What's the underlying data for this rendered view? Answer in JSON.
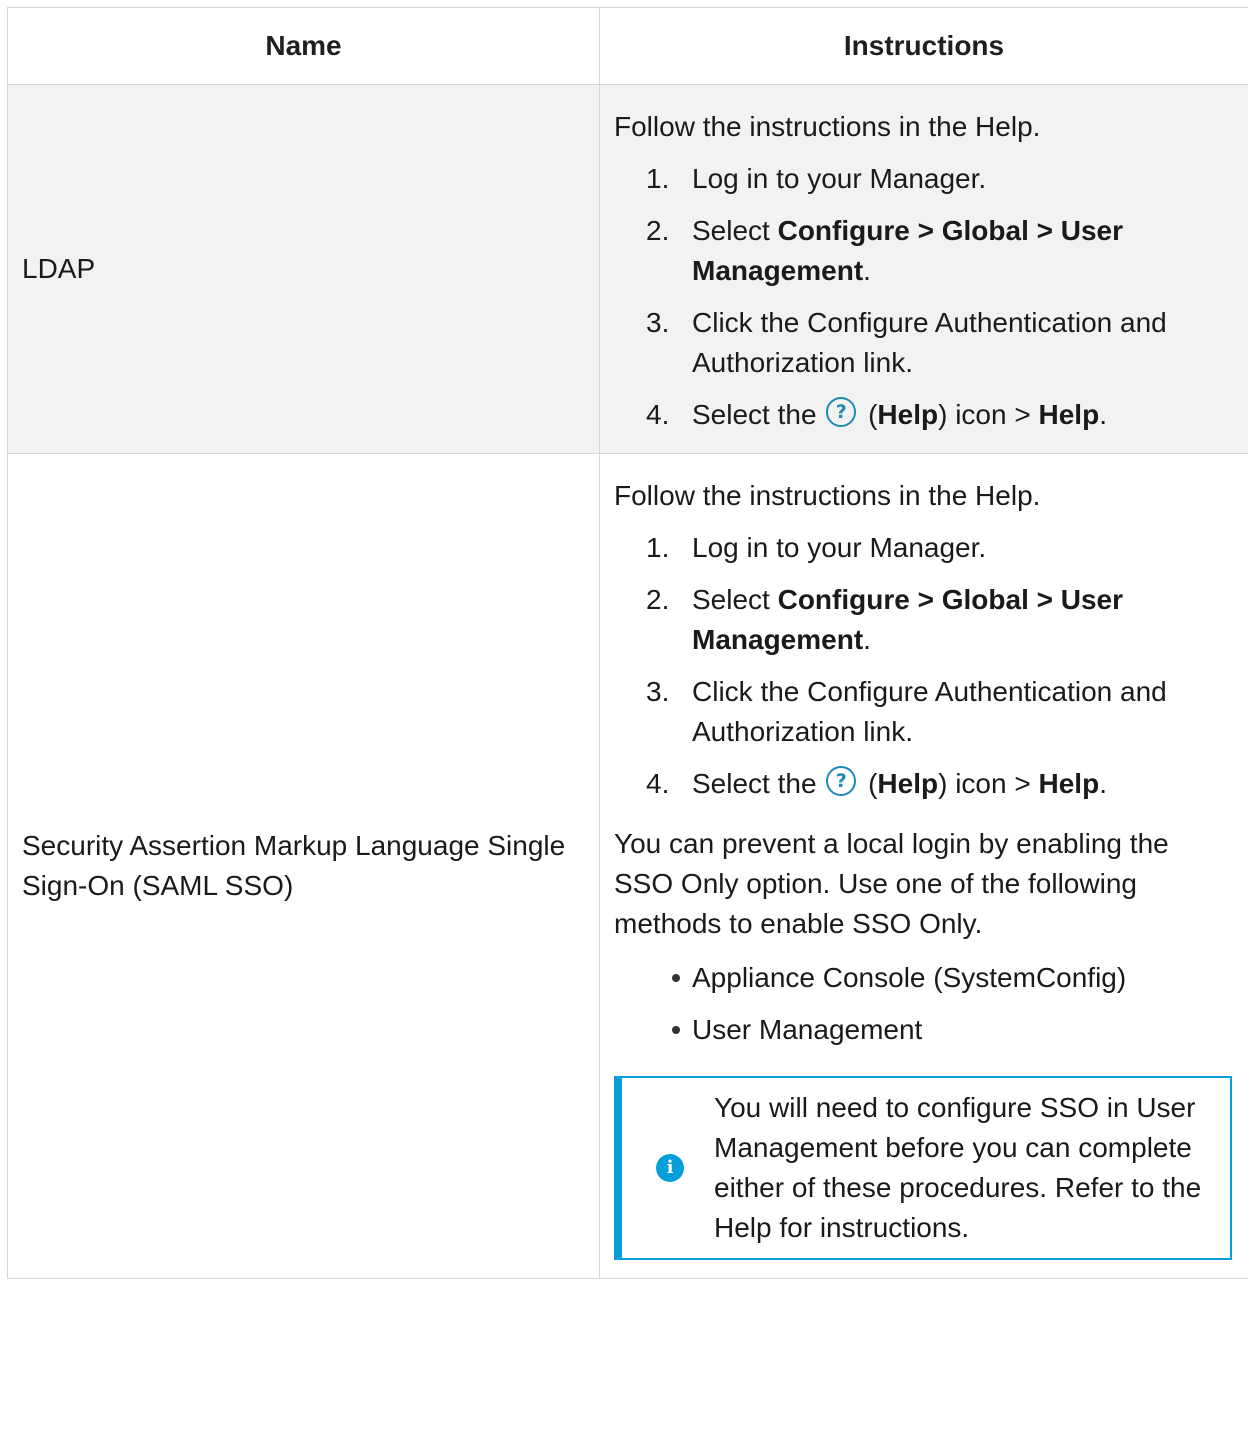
{
  "table": {
    "headers": {
      "name": "Name",
      "instructions": "Instructions"
    },
    "rows": [
      {
        "name": "LDAP",
        "intro": "Follow the instructions in the Help.",
        "steps": [
          {
            "num": "1.",
            "text": "Log in to your Manager."
          },
          {
            "num": "2.",
            "pre": "Select ",
            "bold": "Configure > Global >  User Management",
            "post": "."
          },
          {
            "num": "3.",
            "text": "Click the Configure Authentication and Authorization link."
          },
          {
            "num": "4.",
            "pre": "Select the ",
            "icon": "?",
            "paren_open": " (",
            "bold1": "Help",
            "mid": ") icon > ",
            "bold2": "Help",
            "post": "."
          }
        ]
      },
      {
        "name": "Security Assertion Markup Language Single Sign-On (SAML SSO)",
        "intro": "Follow the instructions in the Help.",
        "steps": [
          {
            "num": "1.",
            "text": "Log in to your Manager."
          },
          {
            "num": "2.",
            "pre": "Select ",
            "bold": "Configure > Global > User Management",
            "post": "."
          },
          {
            "num": "3.",
            "text": "Click the Configure Authentication and Authorization link."
          },
          {
            "num": "4.",
            "pre": "Select the ",
            "icon": "?",
            "paren_open": " (",
            "bold1": "Help",
            "mid": ") icon > ",
            "bold2": "Help",
            "post": "."
          }
        ],
        "paragraph": "You can prevent a local login by enabling the SSO Only option. Use one of the following methods to enable SSO Only.",
        "bullets": [
          "Appliance Console (SystemConfig)",
          "User Management"
        ],
        "note": {
          "icon": "i",
          "text": "You will need to configure SSO in User Management before you can complete either of these procedures. Refer to the Help for instructions."
        }
      }
    ]
  },
  "colors": {
    "note_accent": "#049fd9",
    "help_icon": "#1f8ab7",
    "row_shade": "#f2f2f2",
    "border": "#d6d6d6"
  },
  "icons": [
    "help-question-icon",
    "info-icon",
    "bullet-icon"
  ]
}
